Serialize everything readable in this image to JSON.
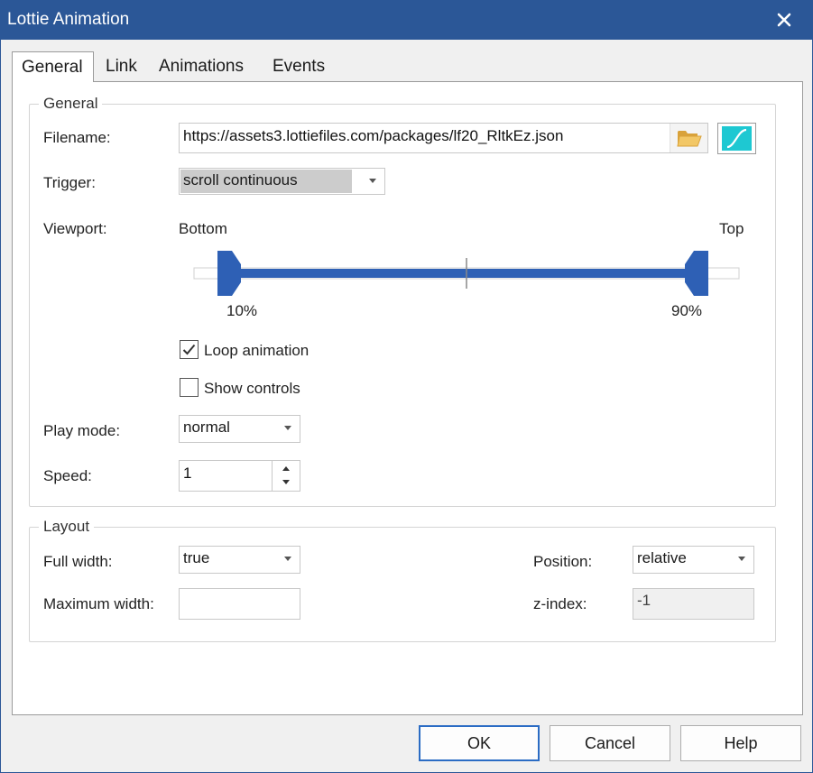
{
  "window": {
    "title": "Lottie Animation"
  },
  "icons": {
    "close": "close-icon",
    "folder": "folder-icon",
    "easing": "easing-curve-icon",
    "check": "checkmark-icon",
    "spin_up": "triangle-up-icon",
    "spin_down": "triangle-down-icon",
    "dropdown": "chevron-down-icon"
  },
  "colors": {
    "accent": "#2b5797",
    "slider": "#2e60b5",
    "easing": "#1ec8d2",
    "folder": "#e8b64a"
  },
  "tabs": [
    {
      "label": "General",
      "active": true
    },
    {
      "label": "Link",
      "active": false
    },
    {
      "label": "Animations",
      "active": false
    },
    {
      "label": "Events",
      "active": false
    }
  ],
  "general": {
    "legend": "General",
    "filename_label": "Filename:",
    "filename_value": "https://assets3.lottiefiles.com/packages/lf20_RltkEz.json",
    "trigger_label": "Trigger:",
    "trigger_value": "scroll continuous",
    "viewport_label": "Viewport:",
    "viewport_bottom": "Bottom",
    "viewport_top": "Top",
    "viewport_start_label": "10%",
    "viewport_end_label": "90%",
    "viewport_start": 0.1,
    "viewport_end": 0.9,
    "loop_label": "Loop animation",
    "loop_checked": true,
    "controls_label": "Show controls",
    "controls_checked": false,
    "playmode_label": "Play mode:",
    "playmode_value": "normal",
    "speed_label": "Speed:",
    "speed_value": "1"
  },
  "layout": {
    "legend": "Layout",
    "fullwidth_label": "Full width:",
    "fullwidth_value": "true",
    "maxwidth_label": "Maximum width:",
    "maxwidth_value": "",
    "position_label": "Position:",
    "position_value": "relative",
    "zindex_label": "z-index:",
    "zindex_value": "-1"
  },
  "buttons": {
    "ok": "OK",
    "cancel": "Cancel",
    "help": "Help"
  }
}
